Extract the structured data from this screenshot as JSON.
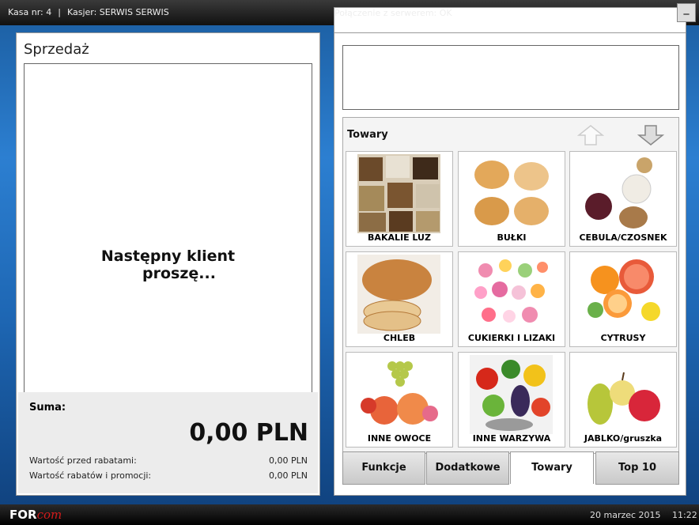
{
  "topbar": {
    "kasa": "Kasa nr: 4",
    "sep": "|",
    "kasjer": "Kasjer: SERWIS SERWIS",
    "connection": "Połączenie z serwerem: OK",
    "minimize": "_"
  },
  "bottombar": {
    "logo_part1": "FOR",
    "logo_part2": "com",
    "date": "20 marzec 2015",
    "time": "11:22"
  },
  "sale": {
    "title": "Sprzedaż",
    "message_line1": "Następny klient",
    "message_line2": "proszę...",
    "suma_label": "Suma:",
    "total": "0,00 PLN",
    "before_discount_label": "Wartość przed rabatami:",
    "before_discount_value": "0,00 PLN",
    "discounts_label": "Wartość rabatów i promocji:",
    "discounts_value": "0,00 PLN"
  },
  "goods": {
    "title": "Towary",
    "items": [
      {
        "label": "BAKALIE LUZ",
        "icon": "dried-fruits-icon"
      },
      {
        "label": "BUŁKI",
        "icon": "bread-rolls-icon"
      },
      {
        "label": "CEBULA/CZOSNEK",
        "icon": "onion-garlic-icon"
      },
      {
        "label": "CHLEB",
        "icon": "bread-icon"
      },
      {
        "label": "CUKIERKI I LIZAKI",
        "icon": "candy-icon"
      },
      {
        "label": "CYTRUSY",
        "icon": "citrus-icon"
      },
      {
        "label": "INNE OWOCE",
        "icon": "fruits-icon"
      },
      {
        "label": "INNE WARZYWA",
        "icon": "vegetables-icon"
      },
      {
        "label": "JABLKO/gruszka",
        "icon": "apple-pear-icon"
      }
    ]
  },
  "tabs": [
    {
      "label": "Funkcje"
    },
    {
      "label": "Dodatkowe"
    },
    {
      "label": "Towary",
      "active": true
    },
    {
      "label": "Top 10"
    }
  ]
}
